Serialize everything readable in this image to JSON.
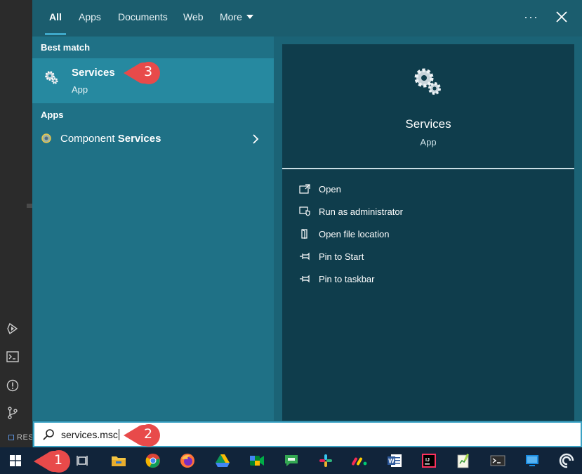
{
  "tabs": [
    {
      "label": "All",
      "active": true
    },
    {
      "label": "Apps"
    },
    {
      "label": "Documents"
    },
    {
      "label": "Web"
    },
    {
      "label": "More"
    }
  ],
  "header": {
    "more_menu_icon": "ellipsis-icon",
    "close_icon": "close-icon"
  },
  "results": {
    "best_match_label": "Best match",
    "best_match": {
      "title": "Services",
      "subtitle": "App",
      "icon": "gears-icon"
    },
    "apps_label": "Apps",
    "apps": [
      {
        "prefix": "Component ",
        "highlight": "Services",
        "icon": "component-services-icon"
      }
    ]
  },
  "detail": {
    "name": "Services",
    "type": "App",
    "actions": [
      {
        "label": "Open",
        "icon": "open-icon"
      },
      {
        "label": "Run as administrator",
        "icon": "shield-icon"
      },
      {
        "label": "Open file location",
        "icon": "file-location-icon"
      },
      {
        "label": "Pin to Start",
        "icon": "pin-icon"
      },
      {
        "label": "Pin to taskbar",
        "icon": "pin-icon"
      }
    ]
  },
  "search": {
    "value": "services.msc"
  },
  "ide": {
    "status_text": "RES"
  },
  "callouts": [
    "1",
    "2",
    "3"
  ],
  "taskbar": {
    "items": [
      "windows-start",
      "search",
      "task-view",
      "file-explorer",
      "chrome",
      "firefox",
      "google-drive",
      "google-meet",
      "google-chat",
      "slack",
      "monday",
      "word",
      "intellij",
      "notepad-plus",
      "terminal",
      "remote-desktop",
      "cortana"
    ]
  },
  "colors": {
    "panel": "#1b6376",
    "list": "#1f7186",
    "selected": "#2689a0",
    "detail": "#0f3d4c",
    "accent": "#3ea8c9",
    "callout": "#e84a4a",
    "taskbar": "#11243a"
  }
}
